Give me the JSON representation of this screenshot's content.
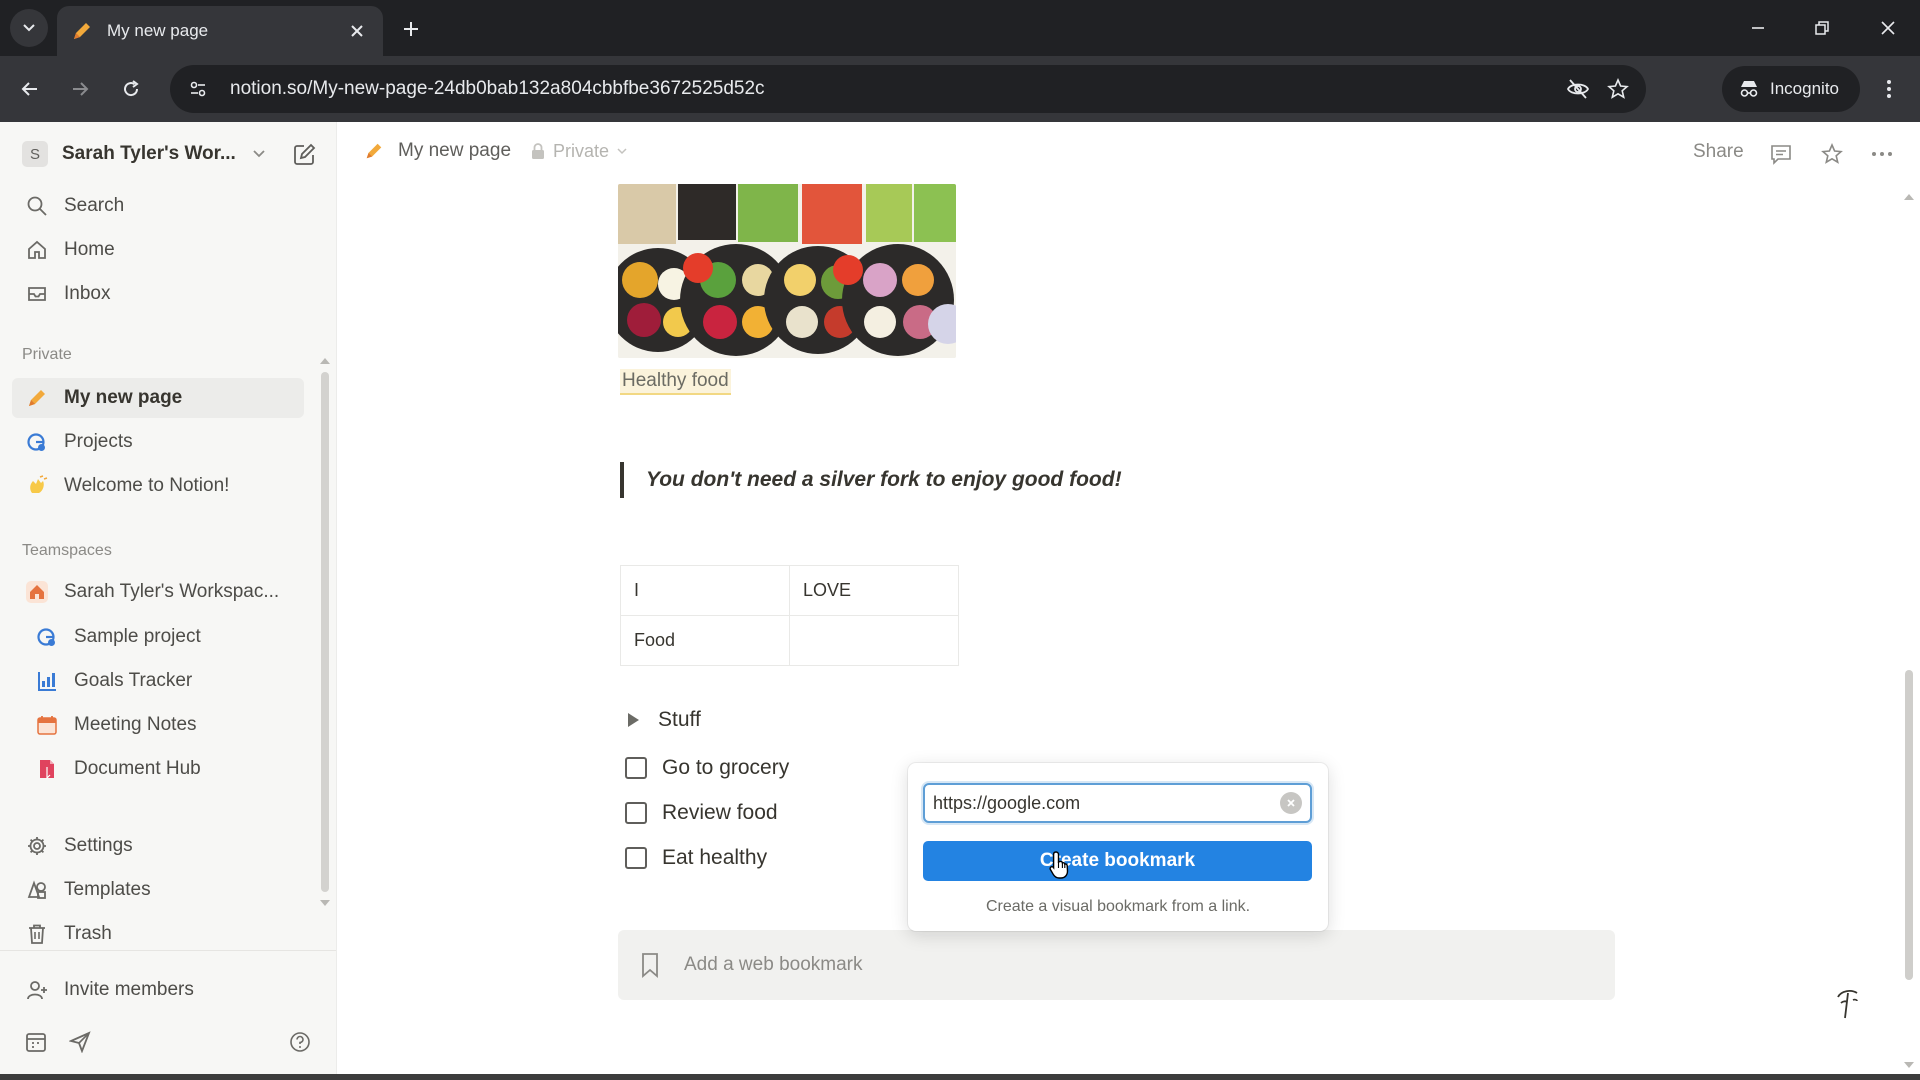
{
  "browser": {
    "tab_title": "My new page",
    "url": "notion.so/My-new-page-24db0bab132a804cbbfbe3672525d52c",
    "incognito_label": "Incognito"
  },
  "sidebar": {
    "workspace_initial": "S",
    "workspace_name": "Sarah Tyler's Wor...",
    "top_items": [
      {
        "label": "Search",
        "icon": "search-icon"
      },
      {
        "label": "Home",
        "icon": "home-icon"
      },
      {
        "label": "Inbox",
        "icon": "inbox-icon"
      }
    ],
    "private_label": "Private",
    "private_items": [
      {
        "label": "My new page",
        "icon": "pencil-icon"
      },
      {
        "label": "Projects",
        "icon": "projects-icon"
      },
      {
        "label": "Welcome to Notion!",
        "icon": "wave-icon"
      }
    ],
    "teamspaces_label": "Teamspaces",
    "teamspace_name": "Sarah Tyler's Workspac...",
    "teamspace_items": [
      {
        "label": "Sample project",
        "icon": "projects-icon"
      },
      {
        "label": "Goals Tracker",
        "icon": "goals-icon"
      },
      {
        "label": "Meeting Notes",
        "icon": "calendar-icon"
      },
      {
        "label": "Document Hub",
        "icon": "document-icon"
      }
    ],
    "bottom_items": [
      {
        "label": "Settings",
        "icon": "gear-icon"
      },
      {
        "label": "Templates",
        "icon": "templates-icon"
      },
      {
        "label": "Trash",
        "icon": "trash-icon"
      }
    ],
    "invite_label": "Invite members"
  },
  "topbar": {
    "page_title": "My new page",
    "privacy_label": "Private",
    "share_label": "Share"
  },
  "content": {
    "image_caption": "Healthy food",
    "quote": "You don't need a silver fork to enjoy good food!",
    "table": [
      [
        "I",
        "LOVE"
      ],
      [
        "Food",
        ""
      ]
    ],
    "toggle_label": "Stuff",
    "todos": [
      "Go to grocery",
      "Review food",
      "Eat healthy"
    ],
    "bookmark_placeholder": "Add a web bookmark"
  },
  "bookmark_popup": {
    "input_value": "https://google.com",
    "button_label": "Create bookmark",
    "hint": "Create a visual bookmark from a link."
  },
  "colors": {
    "accent": "#2383e2",
    "chrome_dark": "#202124",
    "chrome_toolbar": "#35363a",
    "sidebar_bg": "#f7f7f5"
  }
}
